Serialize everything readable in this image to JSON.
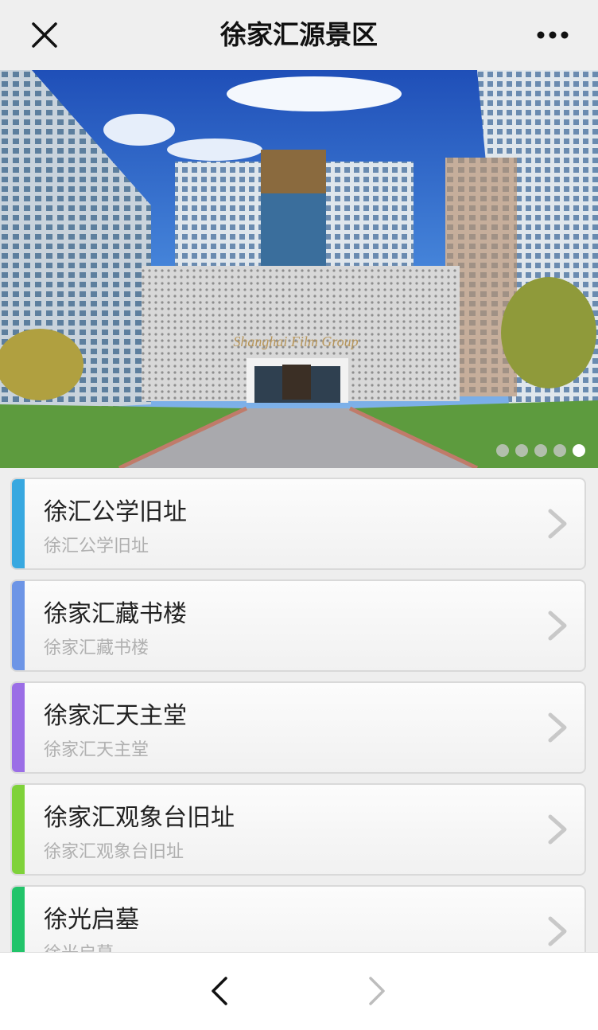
{
  "header": {
    "title": "徐家汇源景区",
    "close_icon": "close-icon",
    "more_icon": "more-icon"
  },
  "banner": {
    "image": "building-photo",
    "slide_count": 5,
    "active_slide": 5
  },
  "items": [
    {
      "title": "徐汇公学旧址",
      "subtitle": "徐汇公学旧址",
      "color": "#38a8e0"
    },
    {
      "title": "徐家汇藏书楼",
      "subtitle": "徐家汇藏书楼",
      "color": "#6d95e6"
    },
    {
      "title": "徐家汇天主堂",
      "subtitle": "徐家汇天主堂",
      "color": "#9b6ee6"
    },
    {
      "title": "徐家汇观象台旧址",
      "subtitle": "徐家汇观象台旧址",
      "color": "#7fd23a"
    },
    {
      "title": "徐光启墓",
      "subtitle": "徐光启墓",
      "color": "#22c46a"
    }
  ],
  "bottom_nav": {
    "back_icon": "chevron-left-icon",
    "forward_icon": "chevron-right-icon"
  }
}
